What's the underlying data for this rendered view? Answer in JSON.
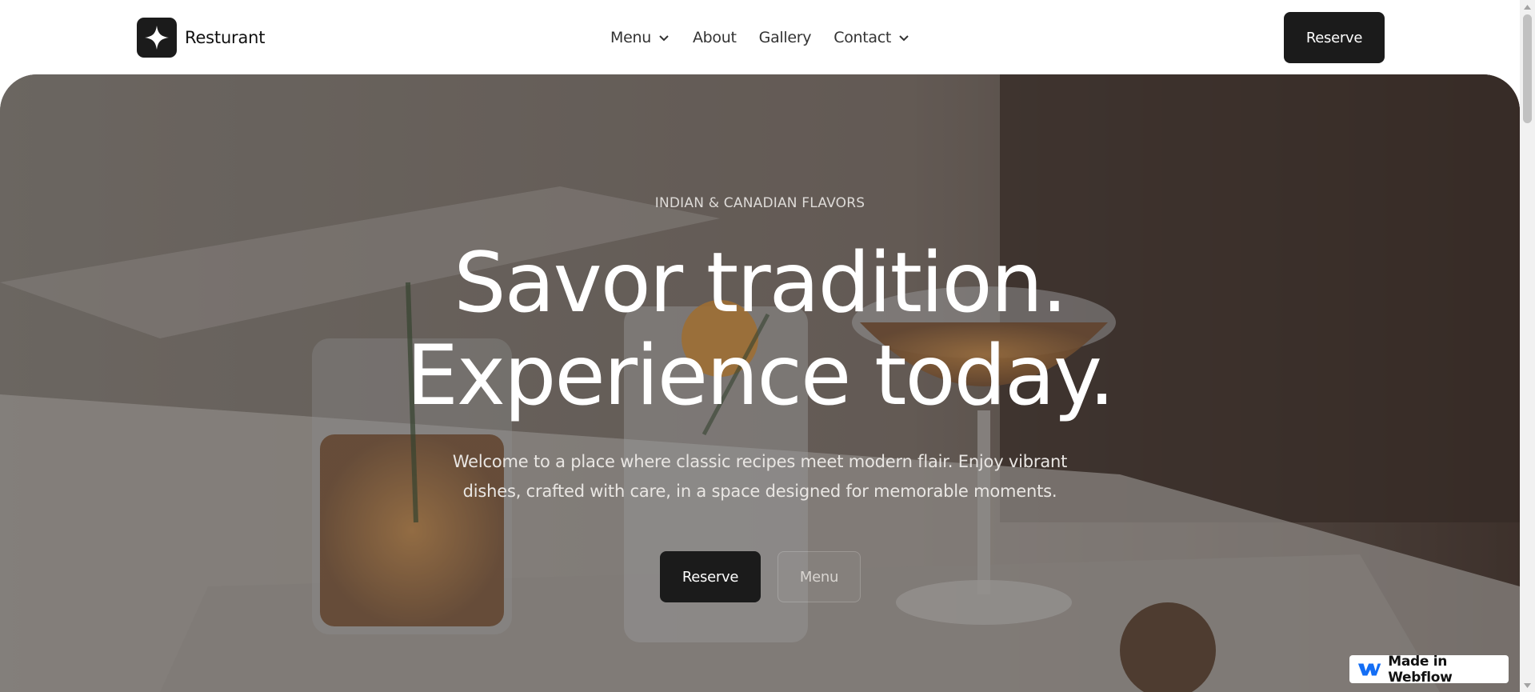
{
  "navbar": {
    "brand_name": "Resturant",
    "links": [
      {
        "label": "Menu",
        "has_dropdown": true
      },
      {
        "label": "About",
        "has_dropdown": false
      },
      {
        "label": "Gallery",
        "has_dropdown": false
      },
      {
        "label": "Contact",
        "has_dropdown": true
      }
    ],
    "reserve_label": "Reserve"
  },
  "hero": {
    "eyebrow": "INDIAN & CANADIAN FLAVORS",
    "headline_line1": "Savor tradition.",
    "headline_line2": "Experience today.",
    "subtext": "Welcome to a place where classic recipes meet modern flair. Enjoy vibrant dishes, crafted with care, in a space designed for memorable moments.",
    "primary_button": "Reserve",
    "secondary_button": "Menu",
    "background_image": "cocktails-on-marble-tray"
  },
  "badge": {
    "label": "Made in Webflow",
    "icon": "webflow-logo-icon"
  },
  "colors": {
    "primary_dark": "#1b1b1b",
    "nav_text": "#333333",
    "hero_text": "#ffffff",
    "webflow_blue": "#146ef5"
  }
}
